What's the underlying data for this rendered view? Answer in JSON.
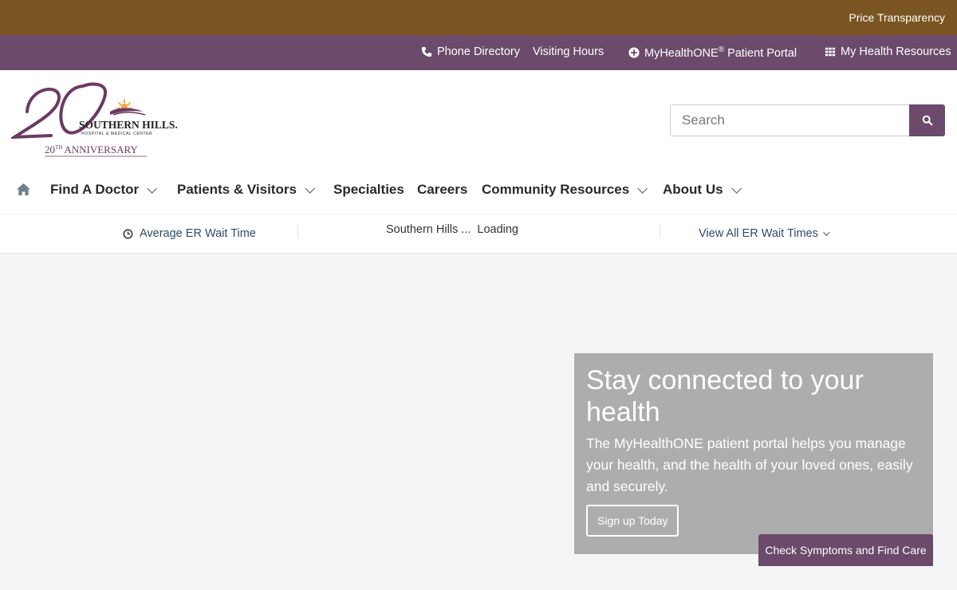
{
  "topbar": {
    "price_transparency": "Price Transparency"
  },
  "utility": {
    "phone_directory": "Phone Directory",
    "visiting_hours": "Visiting Hours",
    "portal_name": "MyHealthONE",
    "portal_reg": "®",
    "portal_suffix": " Patient Portal",
    "health_resources": "My Health Resources"
  },
  "logo": {
    "line1": "SOUTHERN HILLS.",
    "line2": "HOSPITAL & MEDICAL CENTER",
    "anniv_num": "20",
    "anniv_sup": "TH",
    "anniv_word": "ANNIVERSARY"
  },
  "search": {
    "placeholder": "Search"
  },
  "nav": {
    "items": [
      {
        "label": "Find A Doctor",
        "dropdown": true
      },
      {
        "label": "Patients & Visitors",
        "dropdown": true
      },
      {
        "label": "Specialties",
        "dropdown": false
      },
      {
        "label": "Careers",
        "dropdown": false
      },
      {
        "label": "Community Resources",
        "dropdown": true
      },
      {
        "label": "About Us",
        "dropdown": true
      }
    ]
  },
  "er": {
    "avg_label": "Average ER Wait Time",
    "facility": "Southern Hills ...",
    "status": "Loading",
    "view_all": "View All ER Wait Times"
  },
  "hero": {
    "title": "Stay connected to your health",
    "body": "The MyHealthONE patient portal helps you manage your health, and the health of your loved ones, easily and securely.",
    "cta": "Sign up Today"
  },
  "check_symptoms": "Check Symptoms and Find Care",
  "colors": {
    "gold": "#7a5522",
    "purple": "#6b4a6b",
    "hero_bg": "#adadad"
  }
}
